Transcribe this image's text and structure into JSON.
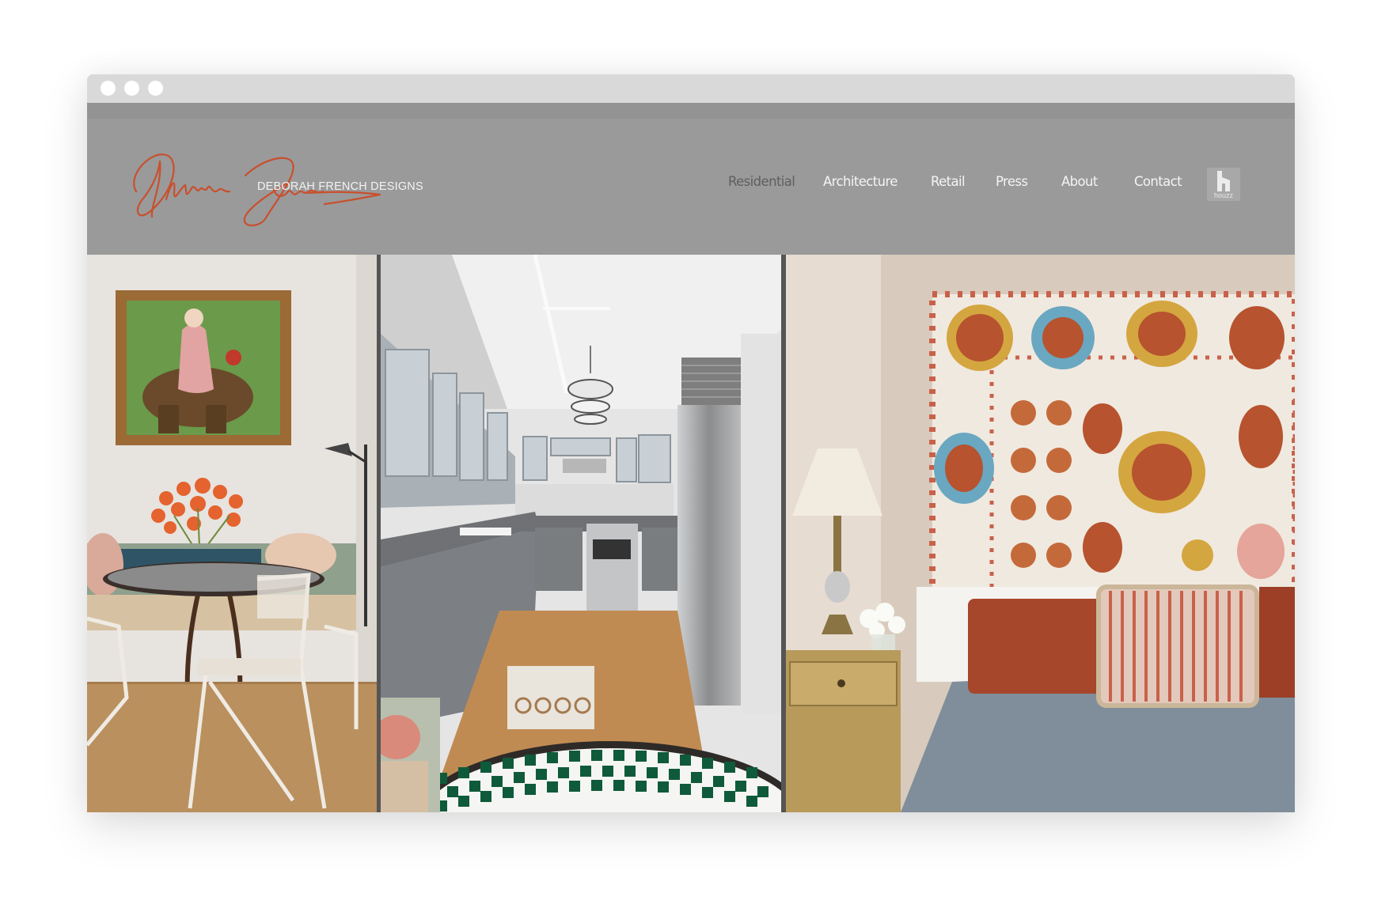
{
  "window": {
    "controls": [
      "close",
      "minimize",
      "maximize"
    ]
  },
  "site": {
    "logo": {
      "signature_alt": "Deborah French signature",
      "wordmark": "DEBORAH FRENCH DESIGNS",
      "signature_color": "#c8502e"
    },
    "nav": {
      "items": [
        {
          "label": "Residential",
          "active": true
        },
        {
          "label": "Architecture",
          "active": false
        },
        {
          "label": "Retail",
          "active": false
        },
        {
          "label": "Press",
          "active": false
        },
        {
          "label": "About",
          "active": false
        },
        {
          "label": "Contact",
          "active": false
        }
      ],
      "social": {
        "icon": "houzz-icon",
        "label": "houzz"
      }
    },
    "colors": {
      "header_bg": "#9a9a9a",
      "nav_text": "#f4f4f4",
      "nav_active": "#5f5f5f"
    },
    "gallery": [
      {
        "name": "dining-nook-photo",
        "description": "Dining nook with framed painting, orange tulips, mosaic table and white iron chairs"
      },
      {
        "name": "kitchen-photo",
        "description": "Gray galley kitchen with glass cabinets, pendant lights, stainless fridge and checkered table"
      },
      {
        "name": "bedroom-photo",
        "description": "Bedroom with suzani headboard, table lamp, rust and striped pillows, blue bedspread"
      }
    ]
  }
}
